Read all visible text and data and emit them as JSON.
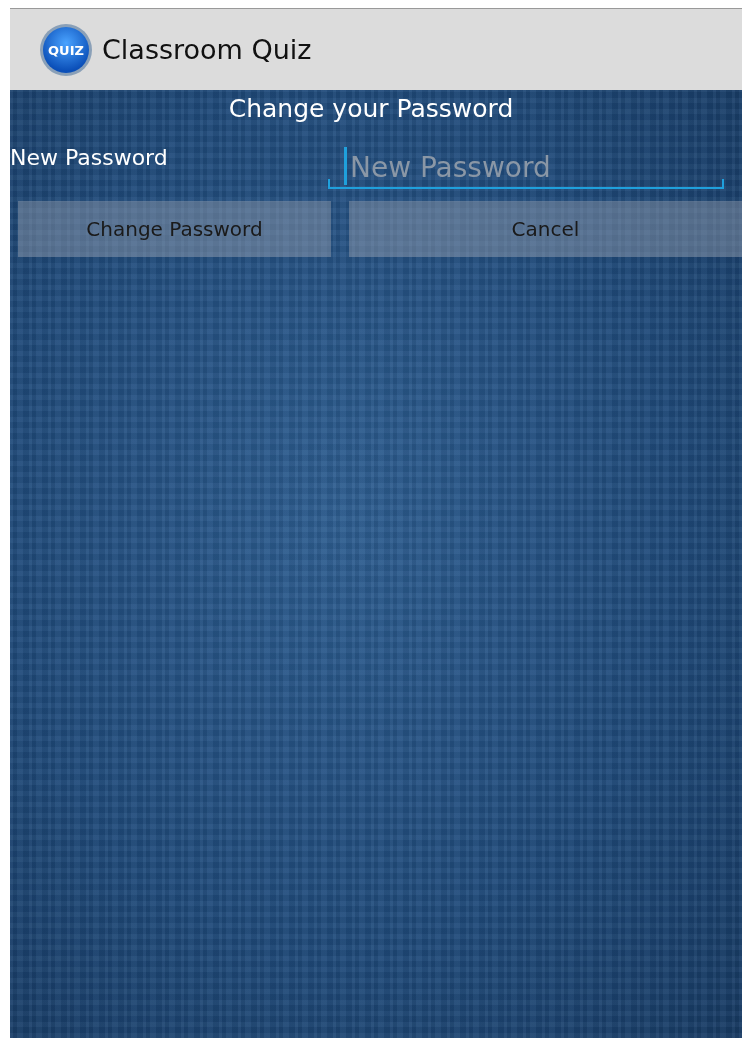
{
  "action_bar": {
    "logo_text": "QUIZ",
    "title": "Classroom Quiz"
  },
  "heading": "Change your Password",
  "form": {
    "label": "New Password",
    "field": {
      "placeholder": "New Password",
      "focused": true
    }
  },
  "buttons": [
    {
      "label": "Change Password"
    },
    {
      "label": "Cancel"
    }
  ]
}
